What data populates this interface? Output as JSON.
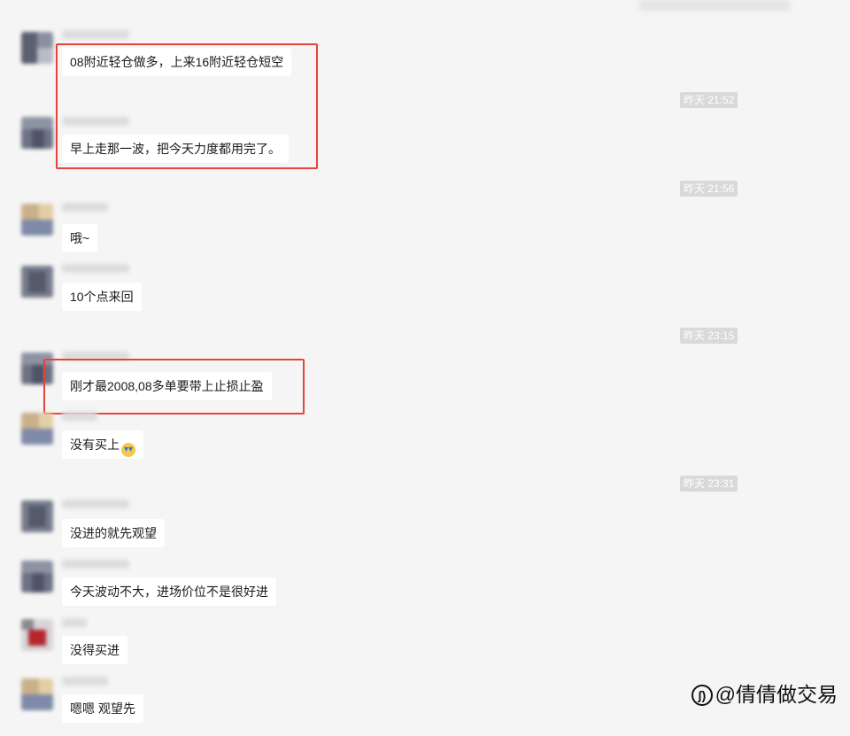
{
  "chat": {
    "timestamps": [
      "昨天 21:52",
      "昨天 21:56",
      "昨天 23:15",
      "昨天 23:31"
    ],
    "messages": [
      {
        "text": "08附近轻仓做多，上来16附近轻仓短空"
      },
      {
        "text": "早上走那一波，把今天力度都用完了。"
      },
      {
        "text": "哦~"
      },
      {
        "text": "10个点来回"
      },
      {
        "text": "刚才最2008,08多单要带上止损止盈"
      },
      {
        "text": "没有买上",
        "emoji": "crying-face-emoji"
      },
      {
        "text": "没进的就先观望"
      },
      {
        "text": "今天波动不大，进场价位不是很好进"
      },
      {
        "text": "没得买进"
      },
      {
        "text": "嗯嗯 观望先"
      }
    ]
  },
  "watermark": {
    "logo": "ʃ)",
    "text": "@倩倩做交易"
  },
  "colors": {
    "background": "#f5f5f5",
    "bubble": "#ffffff",
    "highlight": "#e8423b",
    "timestamp_bg": "#d9d9d9"
  }
}
